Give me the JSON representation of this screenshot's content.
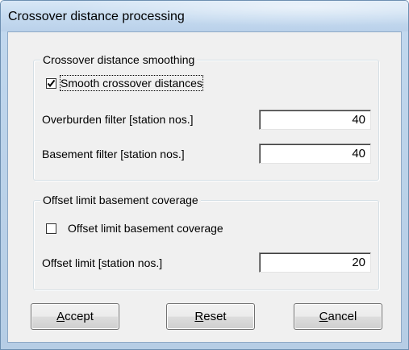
{
  "window": {
    "title": "Crossover distance processing"
  },
  "smoothing_group": {
    "title": "Crossover distance smoothing",
    "smooth_checkbox": {
      "label": "Smooth crossover distances",
      "checked": true
    },
    "overburden_filter": {
      "label": "Overburden filter [station nos.]",
      "value": "40"
    },
    "basement_filter": {
      "label": "Basement filter [station nos.]",
      "value": "40"
    }
  },
  "offset_group": {
    "title": "Offset limit basement coverage",
    "offset_checkbox": {
      "label": "Offset limit basement coverage",
      "checked": false
    },
    "offset_limit": {
      "label": "Offset limit [station nos.]",
      "value": "20"
    }
  },
  "buttons": {
    "accept": {
      "accel": "A",
      "rest": "ccept"
    },
    "reset": {
      "accel": "R",
      "rest": "eset"
    },
    "cancel": {
      "accel": "C",
      "rest": "ancel"
    }
  }
}
